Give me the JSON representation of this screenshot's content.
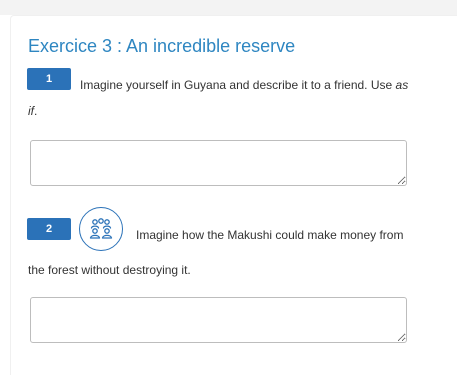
{
  "exercise": {
    "title": "Exercice 3 : An incredible reserve"
  },
  "questions": [
    {
      "number": "1",
      "text_line1_before": "Imagine yourself in Guyana and describe it to a friend. Use ",
      "text_line1_emphasis": "as",
      "text_line2_emphasis": "if",
      "text_line2_after": ".",
      "answer_value": "",
      "answer_placeholder": ""
    },
    {
      "number": "2",
      "icon": "group-work-icon",
      "text_line1": "Imagine how the Makushi could make money from",
      "text_line2": "the forest without destroying it.",
      "answer_value": "",
      "answer_placeholder": ""
    }
  ],
  "colors": {
    "title": "#2e86c1",
    "badge": "#2b72b8",
    "text": "#333333",
    "border": "#bdbdbd"
  }
}
